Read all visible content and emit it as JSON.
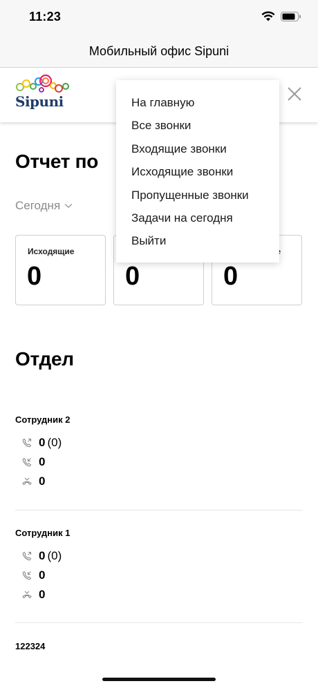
{
  "status_bar": {
    "time": "11:23",
    "icons": [
      "wifi-icon",
      "battery-icon"
    ]
  },
  "nav": {
    "title": "Мобильный офис Sipuni"
  },
  "logo": {
    "text": "Sipuni"
  },
  "report": {
    "title": "Отчет по",
    "period": "Сегодня",
    "cards": [
      {
        "label": "Исходящие",
        "value": "0"
      },
      {
        "label": "",
        "value": "0"
      },
      {
        "label": "е",
        "value": "0"
      }
    ]
  },
  "department": {
    "title": "Отдел",
    "employees": [
      {
        "name": "Сотрудник 2",
        "outgoing": "0",
        "outgoing_sub": "(0)",
        "incoming": "0",
        "missed": "0"
      },
      {
        "name": "Сотрудник 1",
        "outgoing": "0",
        "outgoing_sub": "(0)",
        "incoming": "0",
        "missed": "0"
      },
      {
        "name": "122324"
      }
    ]
  },
  "menu": {
    "items": [
      "На главную",
      "Все звонки",
      "Входящие звонки",
      "Исходящие звонки",
      "Пропущенные звонки",
      "Задачи на сегодня",
      "Выйти"
    ]
  },
  "colors": {
    "accent_text": "#1f3d6b",
    "muted": "#8a8a8a",
    "border": "#cfcfcf"
  }
}
